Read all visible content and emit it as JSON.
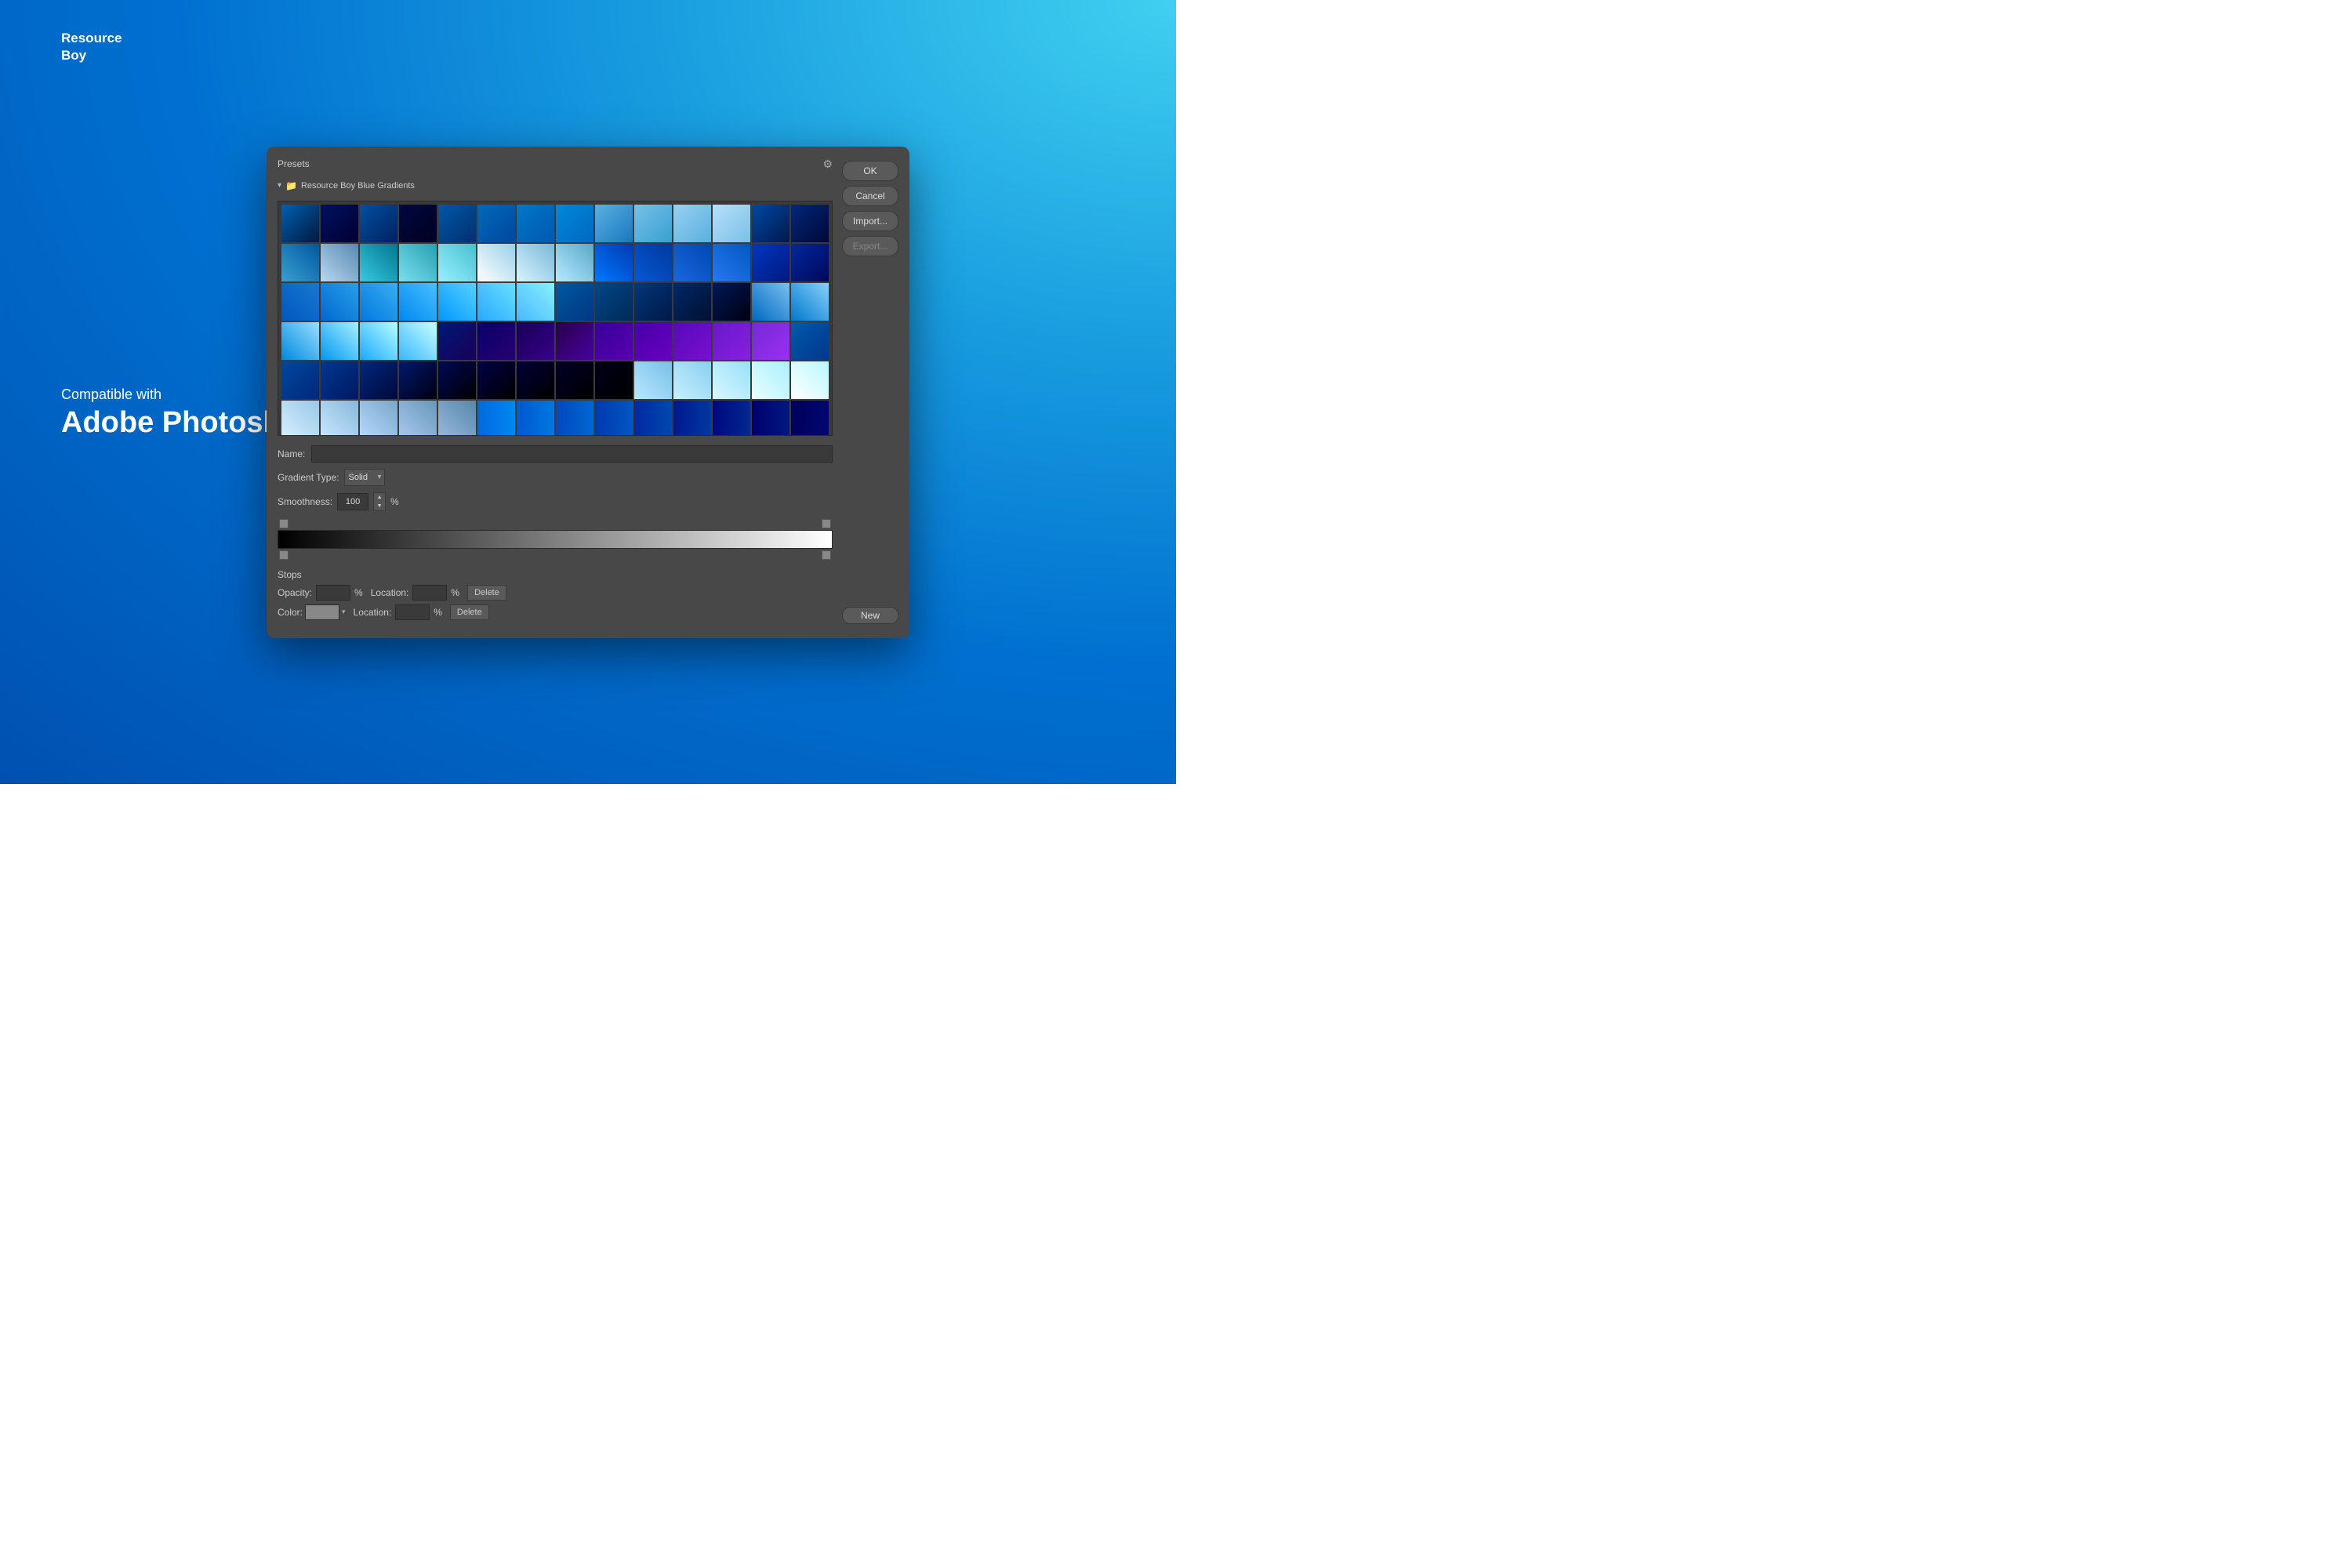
{
  "brand": {
    "name_line1": "Resource",
    "name_line2": "Boy",
    "compat_text": "Compatible with",
    "adobe_text": "Adobe Photoshop"
  },
  "dialog": {
    "presets_label": "Presets",
    "gear_icon": "⚙",
    "folder_name": "Resource Boy Blue Gradients",
    "name_label": "Name:",
    "new_button": "New",
    "gradient_type_label": "Gradient Type:",
    "gradient_type_value": "Solid",
    "smoothness_label": "Smoothness:",
    "smoothness_value": "100",
    "smoothness_unit": "%",
    "stops_title": "Stops",
    "opacity_label": "Opacity:",
    "opacity_unit": "%",
    "location_label": "Location:",
    "location_unit": "%",
    "delete_label": "Delete",
    "color_label": "Color:",
    "location2_label": "Location:",
    "location2_unit": "%",
    "delete2_label": "Delete",
    "ok_button": "OK",
    "cancel_button": "Cancel",
    "import_button": "Import...",
    "export_button": "Export..."
  },
  "gradients": [
    {
      "colors": [
        "#0080c0",
        "#003090"
      ],
      "angle": 135
    },
    {
      "colors": [
        "#000060",
        "#002080"
      ],
      "angle": 135
    },
    {
      "colors": [
        "#0050a0",
        "#003070"
      ],
      "angle": 135
    },
    {
      "colors": [
        "#001850",
        "#000830"
      ],
      "angle": 135
    },
    {
      "colors": [
        "#0060b0",
        "#004090"
      ],
      "angle": 135
    },
    {
      "colors": [
        "#0070c0",
        "#0050a0"
      ],
      "angle": 135
    },
    {
      "colors": [
        "#0080d0",
        "#0060b0"
      ],
      "angle": 135
    },
    {
      "colors": [
        "#0090e0",
        "#0070c0"
      ],
      "angle": 135
    },
    {
      "colors": [
        "#60b0e0",
        "#2080c0"
      ],
      "angle": 135
    },
    {
      "colors": [
        "#80c0e8",
        "#40a0d0"
      ],
      "angle": 135
    },
    {
      "colors": [
        "#a0d0f0",
        "#60b0e0"
      ],
      "angle": 135
    },
    {
      "colors": [
        "#c0e0f8",
        "#80c0e8"
      ],
      "angle": 135
    },
    {
      "colors": [
        "#0050a0",
        "#0020600"
      ],
      "angle": 135
    },
    {
      "colors": [
        "#003080",
        "#001040"
      ],
      "angle": 135
    },
    {
      "colors": [
        "#40a0d0",
        "#0060a0"
      ],
      "angle": 45
    },
    {
      "colors": [
        "#c0d8f0",
        "#608ab0"
      ],
      "angle": 45
    },
    {
      "colors": [
        "#40c8e0",
        "#008090"
      ],
      "angle": 45
    },
    {
      "colors": [
        "#80e0f0",
        "#30a0b0"
      ],
      "angle": 45
    },
    {
      "colors": [
        "#a0f0ff",
        "#50c0d0"
      ],
      "angle": 45
    },
    {
      "colors": [
        "#ffffff",
        "#a0d0e8"
      ],
      "angle": 45
    },
    {
      "colors": [
        "#e0f4ff",
        "#80b8d8"
      ],
      "angle": 45
    },
    {
      "colors": [
        "#c0eaff",
        "#60a8c8"
      ],
      "angle": 45
    },
    {
      "colors": [
        "#0080ff",
        "#0040b0"
      ],
      "angle": 45
    },
    {
      "colors": [
        "#1060d0",
        "#0040a0"
      ],
      "angle": 45
    },
    {
      "colors": [
        "#2070e0",
        "#0050b0"
      ],
      "angle": 45
    },
    {
      "colors": [
        "#3080f0",
        "#0060c0"
      ],
      "angle": 45
    },
    {
      "colors": [
        "#0040c0",
        "#002080"
      ],
      "angle": 135
    },
    {
      "colors": [
        "#0030a0",
        "#001060"
      ],
      "angle": 135
    },
    {
      "colors": [
        "#0060c0",
        "#2080d0"
      ],
      "angle": 45
    },
    {
      "colors": [
        "#0070d0",
        "#30a0e8"
      ],
      "angle": 45
    },
    {
      "colors": [
        "#0080e0",
        "#40b0f0"
      ],
      "angle": 45
    },
    {
      "colors": [
        "#0090f0",
        "#50c0ff"
      ],
      "angle": 45
    },
    {
      "colors": [
        "#00a0ff",
        "#60d0ff"
      ],
      "angle": 45
    },
    {
      "colors": [
        "#30b0ff",
        "#70e0ff"
      ],
      "angle": 45
    },
    {
      "colors": [
        "#50c0ff",
        "#90f0ff"
      ],
      "angle": 45
    },
    {
      "colors": [
        "#0060a0",
        "#004080"
      ],
      "angle": 135
    },
    {
      "colors": [
        "#0050900",
        "#003060"
      ],
      "angle": 135
    },
    {
      "colors": [
        "#004080",
        "#002060"
      ],
      "angle": 135
    },
    {
      "colors": [
        "#003070",
        "#001840"
      ],
      "angle": 135
    },
    {
      "colors": [
        "#002060",
        "#000820"
      ],
      "angle": 135
    },
    {
      "colors": [
        "#0070c0",
        "#80c0f0"
      ],
      "angle": 45
    },
    {
      "colors": [
        "#0080d0",
        "#90d0f8"
      ],
      "angle": 45
    },
    {
      "colors": [
        "#0090e0",
        "#a0e0ff"
      ],
      "angle": 45
    },
    {
      "colors": [
        "#00a0f0",
        "#b0f0ff"
      ],
      "angle": 45
    },
    {
      "colors": [
        "#20b0ff",
        "#c0ffff"
      ],
      "angle": 45
    },
    {
      "colors": [
        "#40c0ff",
        "#d0ffff"
      ],
      "angle": 45
    },
    {
      "colors": [
        "#002080",
        "#200060"
      ],
      "angle": 135
    },
    {
      "colors": [
        "#100070",
        "#300080"
      ],
      "angle": 135
    },
    {
      "colors": [
        "#200060",
        "#400090"
      ],
      "angle": 135
    },
    {
      "colors": [
        "#300050",
        "#5000a0"
      ],
      "angle": 135
    },
    {
      "colors": [
        "#4000a0",
        "#6000b0"
      ],
      "angle": 135
    },
    {
      "colors": [
        "#5000b0",
        "#7000c0"
      ],
      "angle": 135
    },
    {
      "colors": [
        "#6000c0",
        "#8010d0"
      ],
      "angle": 135
    },
    {
      "colors": [
        "#7010d0",
        "#9020e0"
      ],
      "angle": 135
    },
    {
      "colors": [
        "#8020e0",
        "#a030f0"
      ],
      "angle": 135
    },
    {
      "colors": [
        "#0060b0",
        "#00408a"
      ],
      "angle": 135
    },
    {
      "colors": [
        "#0050a0",
        "#003080"
      ],
      "angle": 135
    },
    {
      "colors": [
        "#004090",
        "#002060"
      ],
      "angle": 135
    },
    {
      "colors": [
        "#003080",
        "#001040"
      ],
      "angle": 135
    },
    {
      "colors": [
        "#002070",
        "#000820"
      ],
      "angle": 135
    },
    {
      "colors": [
        "#001060",
        "#000010"
      ],
      "angle": 135
    },
    {
      "colors": [
        "#000050",
        "#000000"
      ],
      "angle": 135
    },
    {
      "colors": [
        "#000040",
        "#000000"
      ],
      "angle": 135
    },
    {
      "colors": [
        "#000030",
        "#000000"
      ],
      "angle": 135
    },
    {
      "colors": [
        "#000020",
        "#000000"
      ],
      "angle": 135
    },
    {
      "colors": [
        "#c0e8ff",
        "#80c0e8"
      ],
      "angle": 45
    },
    {
      "colors": [
        "#d0f0ff",
        "#90d0f0"
      ],
      "angle": 45
    },
    {
      "colors": [
        "#e0f8ff",
        "#a0e0f8"
      ],
      "angle": 45
    },
    {
      "colors": [
        "#f0ffff",
        "#b0f0ff"
      ],
      "angle": 45
    },
    {
      "colors": [
        "#ffffff",
        "#c0f8ff"
      ],
      "angle": 45
    },
    {
      "colors": [
        "#e0f0ff",
        "#a0c8e8"
      ],
      "angle": 45
    },
    {
      "colors": [
        "#d0e8ff",
        "#90b8d8"
      ],
      "angle": 45
    },
    {
      "colors": [
        "#c0d8ff",
        "#80a8c8"
      ],
      "angle": 45
    },
    {
      "colors": [
        "#b0c8f0",
        "#7098b8"
      ],
      "angle": 45
    },
    {
      "colors": [
        "#a0b8e0",
        "#6088a8"
      ],
      "angle": 45
    },
    {
      "colors": [
        "#0070e0",
        "#0090f0"
      ],
      "angle": 90
    },
    {
      "colors": [
        "#0060d0",
        "#0080e0"
      ],
      "angle": 90
    },
    {
      "colors": [
        "#0050c0",
        "#0070d0"
      ],
      "angle": 90
    },
    {
      "colors": [
        "#0040b0",
        "#0060c0"
      ],
      "angle": 90
    },
    {
      "colors": [
        "#0030a0",
        "#0050b0"
      ],
      "angle": 90
    },
    {
      "colors": [
        "#002090",
        "#0040a0"
      ],
      "angle": 90
    },
    {
      "colors": [
        "#001080",
        "#003090"
      ],
      "angle": 90
    },
    {
      "colors": [
        "#000070",
        "#002080"
      ],
      "angle": 90
    },
    {
      "colors": [
        "#000060",
        "#001070"
      ],
      "angle": 90
    },
    {
      "colors": [
        "#000050",
        "#000060"
      ],
      "angle": 90
    },
    {
      "colors": [
        "#0080ff",
        "#00c0ff"
      ],
      "angle": 45
    },
    {
      "colors": [
        "#10a0ff",
        "#30d0ff"
      ],
      "angle": 45
    },
    {
      "colors": [
        "#20c0ff",
        "#50e0ff"
      ],
      "angle": 45
    },
    {
      "colors": [
        "#30d0ff",
        "#60f0ff"
      ],
      "angle": 45
    },
    {
      "colors": [
        "#40e0ff",
        "#70ffff"
      ],
      "angle": 45
    },
    {
      "colors": [
        "#20a0c8",
        "#0070a0"
      ],
      "angle": 135
    },
    {
      "colors": [
        "#1890b8",
        "#0060908"
      ],
      "angle": 135
    },
    {
      "colors": [
        "#1080a8",
        "#005080"
      ],
      "angle": 135
    },
    {
      "colors": [
        "#087090",
        "#004060"
      ],
      "angle": 135
    },
    {
      "colors": [
        "#006080",
        "#003050"
      ],
      "angle": 135
    }
  ]
}
